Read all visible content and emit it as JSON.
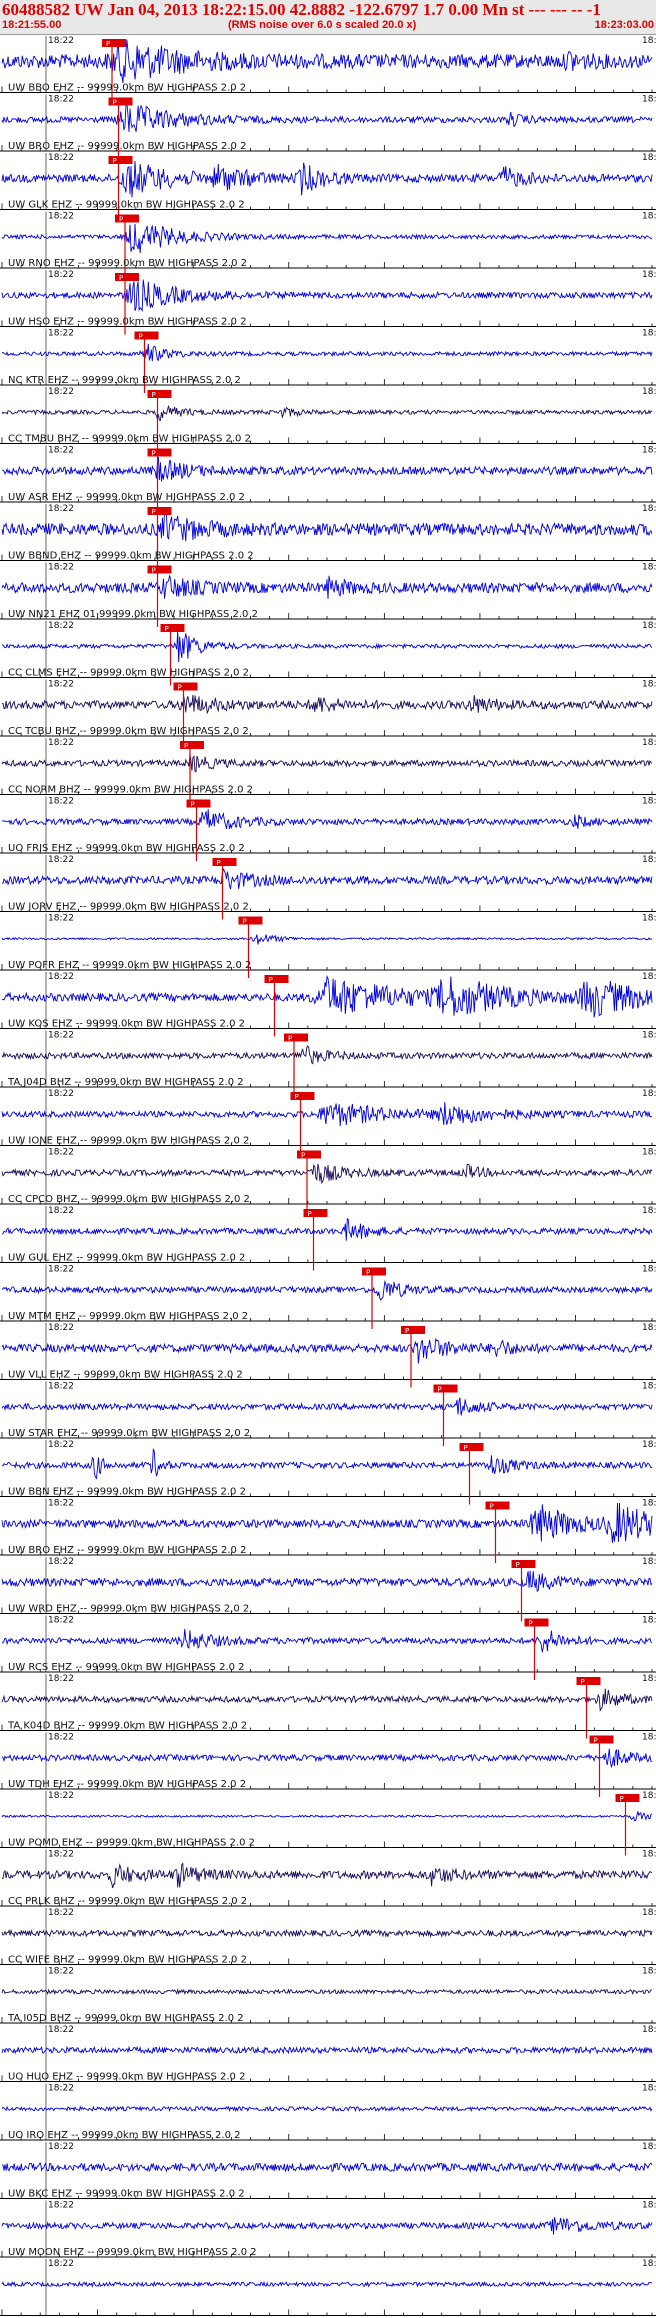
{
  "header": {
    "title": "60488582 UW Jan 04, 2013 18:22:15.00   42.8882 -122.6797  1.7 0.00 Mn st --- --- --  -1",
    "start_time": "18:21:55.00",
    "note": "(RMS noise over 6.0 s scaled 20.0 x)",
    "end_time": "18:23:03.00"
  },
  "chart_data": {
    "type": "line",
    "title": "60488582 UW Jan 04, 2013 18:22:15.00",
    "time_range": [
      "18:21:55.00",
      "18:23:03.00"
    ],
    "minute_label": "18:22",
    "right_label": "18:2",
    "pick_label": "P",
    "colors": {
      "blue": "#0000dd",
      "dark": "#1a0a5a",
      "pick": "#dd0000",
      "axis": "#000000"
    },
    "traces": [
      {
        "label": "",
        "color": "blue",
        "amp": 7,
        "pick": 0.16,
        "bursts": [
          [
            0.18,
            0.08,
            20
          ],
          [
            0.87,
            0.02,
            8
          ]
        ]
      },
      {
        "label": "UW BBO EHZ -- 99999.0km BW  HIGHPASS  2.0  2",
        "color": "blue",
        "amp": 3,
        "pick": 0.17,
        "bursts": [
          [
            0.19,
            0.07,
            16
          ],
          [
            0.78,
            0.02,
            6
          ]
        ]
      },
      {
        "label": "UW BRO EHZ -- 99999.0km BW  HIGHPASS  2.0  2",
        "color": "blue",
        "amp": 4,
        "pick": 0.17,
        "bursts": [
          [
            0.19,
            0.06,
            18
          ],
          [
            0.33,
            0.04,
            12
          ],
          [
            0.46,
            0.03,
            14
          ],
          [
            0.77,
            0.03,
            10
          ]
        ]
      },
      {
        "label": "UW GLK EHZ -- 99999.0km BW  HIGHPASS  2.0  2",
        "color": "blue",
        "amp": 2,
        "pick": 0.18,
        "bursts": [
          [
            0.2,
            0.06,
            18
          ]
        ]
      },
      {
        "label": "UW RNO EHZ -- 99999.0km BW  HIGHPASS  2.0  2",
        "color": "blue",
        "amp": 3,
        "pick": 0.18,
        "bursts": [
          [
            0.2,
            0.06,
            17
          ]
        ]
      },
      {
        "label": "UW HSO EHZ -- 99999.0km BW  HIGHPASS  2.0  2",
        "color": "blue",
        "amp": 2,
        "pick": 0.21,
        "bursts": [
          [
            0.22,
            0.03,
            10
          ]
        ]
      },
      {
        "label": "NC KTR EHZ -- 99999.0km BW  HIGHPASS  2.0  2",
        "color": "dark",
        "amp": 2,
        "pick": 0.23,
        "bursts": [
          [
            0.24,
            0.03,
            8
          ],
          [
            0.43,
            0.02,
            5
          ]
        ]
      },
      {
        "label": "CC TMBU BHZ -- 99999.0km BW  HIGHPASS  2.0  2",
        "color": "blue",
        "amp": 4,
        "pick": 0.23,
        "bursts": [
          [
            0.24,
            0.04,
            10
          ]
        ]
      },
      {
        "label": "UW ASR EHZ -- 99999.0km BW  HIGHPASS  2.0  2",
        "color": "blue",
        "amp": 6,
        "pick": 0.23,
        "bursts": [
          [
            0.25,
            0.05,
            12
          ]
        ]
      },
      {
        "label": "UW BBND EHZ -- 99999.0km BW  HIGHPASS  2.0  2",
        "color": "blue",
        "amp": 5,
        "pick": 0.23,
        "bursts": [
          [
            0.25,
            0.04,
            10
          ],
          [
            0.5,
            0.03,
            8
          ]
        ]
      },
      {
        "label": "UW NN21 EHZ 01 99999.0km BW  HIGHPASS  2.0  2",
        "color": "blue",
        "amp": 2,
        "pick": 0.25,
        "bursts": [
          [
            0.27,
            0.03,
            18
          ]
        ]
      },
      {
        "label": "CC CLMS EHZ -- 99999.0km BW  HIGHPASS  2.0  2",
        "color": "dark",
        "amp": 4,
        "pick": 0.27,
        "bursts": [
          [
            0.28,
            0.04,
            10
          ],
          [
            0.48,
            0.03,
            8
          ],
          [
            0.72,
            0.03,
            8
          ]
        ]
      },
      {
        "label": "CC TCBU BHZ -- 99999.0km BW  HIGHPASS  2.0  2",
        "color": "dark",
        "amp": 3,
        "pick": 0.28,
        "bursts": [
          [
            0.29,
            0.03,
            8
          ]
        ]
      },
      {
        "label": "CC NORM BHZ -- 99999.0km BW  HIGHPASS  2.0  2",
        "color": "blue",
        "amp": 3,
        "pick": 0.29,
        "bursts": [
          [
            0.31,
            0.04,
            12
          ],
          [
            0.88,
            0.02,
            6
          ]
        ]
      },
      {
        "label": "UO FRIS EHZ -- 99999.0km BW  HIGHPASS  2.0  2",
        "color": "blue",
        "amp": 4,
        "pick": 0.33,
        "bursts": [
          [
            0.34,
            0.04,
            9
          ]
        ]
      },
      {
        "label": "UW JORV EHZ -- 99999.0km BW  HIGHPASS  2.0  2",
        "color": "blue",
        "amp": 1,
        "pick": 0.37,
        "bursts": [
          [
            0.39,
            0.03,
            6
          ]
        ]
      },
      {
        "label": "UW POFR EHZ -- 99999.0km BW  HIGHPASS  2.0  2",
        "color": "blue",
        "amp": 4,
        "pick": 0.41,
        "bursts": [
          [
            0.5,
            0.1,
            20
          ],
          [
            0.68,
            0.08,
            20
          ],
          [
            0.9,
            0.08,
            18
          ]
        ]
      },
      {
        "label": "UW KOS EHZ -- 99999.0km BW  HIGHPASS  2.0  2",
        "color": "dark",
        "amp": 3,
        "pick": 0.44,
        "bursts": [
          [
            0.46,
            0.03,
            10
          ]
        ]
      },
      {
        "label": "TA J04D BHZ -- 99999.0km BW  HIGHPASS  2.0  2",
        "color": "blue",
        "amp": 3,
        "pick": 0.45,
        "bursts": [
          [
            0.5,
            0.08,
            12
          ],
          [
            0.68,
            0.06,
            10
          ]
        ]
      },
      {
        "label": "UW IONE EHZ -- 99999.0km BW  HIGHPASS  2.0  2",
        "color": "dark",
        "amp": 3,
        "pick": 0.46,
        "bursts": [
          [
            0.48,
            0.04,
            10
          ],
          [
            0.71,
            0.02,
            8
          ]
        ]
      },
      {
        "label": "CC CPCO BHZ -- 99999.0km BW  HIGHPASS  2.0  2",
        "color": "blue",
        "amp": 3,
        "pick": 0.47,
        "bursts": [
          [
            0.53,
            0.03,
            10
          ]
        ]
      },
      {
        "label": "UW GUL EHZ -- 99999.0km BW  HIGHPASS  2.0  2",
        "color": "blue",
        "amp": 3,
        "pick": 0.56,
        "bursts": [
          [
            0.58,
            0.03,
            12
          ]
        ]
      },
      {
        "label": "UW MTM EHZ -- 99999.0km BW  HIGHPASS  2.0  2",
        "color": "blue",
        "amp": 4,
        "pick": 0.62,
        "bursts": [
          [
            0.64,
            0.04,
            12
          ],
          [
            0.76,
            0.02,
            8
          ]
        ]
      },
      {
        "label": "UW VLL EHZ -- 99999.0km BW  HIGHPASS  2.0  2",
        "color": "blue",
        "amp": 3,
        "pick": 0.67,
        "bursts": [
          [
            0.7,
            0.03,
            9
          ]
        ]
      },
      {
        "label": "UW STAR EHZ -- 99999.0km BW  HIGHPASS  2.0  2",
        "color": "blue",
        "amp": 3,
        "pick": 0.71,
        "bursts": [
          [
            0.14,
            0.01,
            18
          ],
          [
            0.23,
            0.01,
            18
          ],
          [
            0.75,
            0.03,
            10
          ]
        ]
      },
      {
        "label": "UW BBN EHZ -- 99999.0km BW  HIGHPASS  2.0  2",
        "color": "blue",
        "amp": 4,
        "pick": 0.75,
        "bursts": [
          [
            0.82,
            0.05,
            20
          ],
          [
            0.94,
            0.06,
            20
          ]
        ]
      },
      {
        "label": "UW BRO EHZ -- 99999.0km BW  HIGHPASS  2.0  2",
        "color": "blue",
        "amp": 4,
        "pick": 0.79,
        "bursts": [
          [
            0.81,
            0.03,
            10
          ]
        ]
      },
      {
        "label": "UW WRD EHZ -- 99999.0km BW  HIGHPASS  2.0  2",
        "color": "blue",
        "amp": 3,
        "pick": 0.81,
        "bursts": [
          [
            0.28,
            0.04,
            10
          ],
          [
            0.83,
            0.03,
            12
          ]
        ]
      },
      {
        "label": "UW RCS EHZ -- 99999.0km BW  HIGHPASS  2.0  2",
        "color": "dark",
        "amp": 3,
        "pick": 0.89,
        "bursts": [
          [
            0.92,
            0.03,
            10
          ]
        ]
      },
      {
        "label": "TA K04D BHZ -- 99999.0km BW  HIGHPASS  2.0  2",
        "color": "blue",
        "amp": 3,
        "pick": 0.91,
        "bursts": [
          [
            0.93,
            0.03,
            10
          ]
        ]
      },
      {
        "label": "UW TDH EHZ -- 99999.0km BW  HIGHPASS  2.0  2",
        "color": "blue",
        "amp": 1,
        "pick": 0.95,
        "bursts": [
          [
            0.97,
            0.02,
            6
          ]
        ]
      },
      {
        "label": "UW POMD EHZ -- 99999.0km BW  HIGHPASS  2.0  2",
        "color": "dark",
        "amp": 4,
        "pick": null,
        "bursts": [
          [
            0.17,
            0.03,
            10
          ],
          [
            0.27,
            0.03,
            10
          ],
          [
            0.66,
            0.03,
            8
          ]
        ]
      },
      {
        "label": "CC PRLK BHZ -- 99999.0km BW  HIGHPASS  2.0  2",
        "color": "dark",
        "amp": 3,
        "pick": null,
        "bursts": []
      },
      {
        "label": "CC WIFE BHZ -- 99999.0km BW  HIGHPASS  2.0  2",
        "color": "dark",
        "amp": 2,
        "pick": null,
        "bursts": []
      },
      {
        "label": "TA I05D BHZ -- 99999.0km BW  HIGHPASS  2.0  2",
        "color": "blue",
        "amp": 3,
        "pick": null,
        "bursts": []
      },
      {
        "label": "UO HUO EHZ -- 99999.0km BW  HIGHPASS  2.0  2",
        "color": "blue",
        "amp": 2,
        "pick": null,
        "bursts": []
      },
      {
        "label": "UO IRO EHZ -- 99999.0km BW  HIGHPASS  2.0  2",
        "color": "blue",
        "amp": 4,
        "pick": null,
        "bursts": []
      },
      {
        "label": "UW BKC EHZ -- 99999.0km BW  HIGHPASS  2.0  2",
        "color": "blue",
        "amp": 3,
        "pick": null,
        "bursts": [
          [
            0.85,
            0.05,
            8
          ]
        ]
      },
      {
        "label": "UW MOON EHZ -- 99999.0km BW  HIGHPASS  2.0  2",
        "color": "blue",
        "amp": 2,
        "pick": null,
        "bursts": []
      }
    ]
  }
}
